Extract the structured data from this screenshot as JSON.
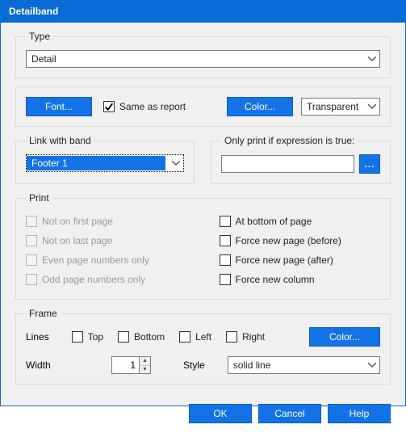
{
  "window": {
    "title": "Detailband"
  },
  "type_group": {
    "legend": "Type",
    "value": "Detail"
  },
  "font_row": {
    "font_btn": "Font...",
    "same_as_report": "Same as report",
    "color_btn": "Color...",
    "color_value": "Transparent"
  },
  "link_group": {
    "legend": "Link with band",
    "value": "Footer 1"
  },
  "expr_group": {
    "legend": "Only print if expression is true:",
    "value": "",
    "browse": "..."
  },
  "print_group": {
    "legend": "Print",
    "left": [
      "Not on first page",
      "Not on last page",
      "Even page numbers only",
      "Odd page numbers only"
    ],
    "right": [
      "At bottom of page",
      "Force new page (before)",
      "Force new page (after)",
      "Force new column"
    ]
  },
  "frame_group": {
    "legend": "Frame",
    "lines_label": "Lines",
    "top": "Top",
    "bottom": "Bottom",
    "left": "Left",
    "right": "Right",
    "color_btn": "Color...",
    "width_label": "Width",
    "width_value": "1",
    "style_label": "Style",
    "style_value": "solid line"
  },
  "buttons": {
    "ok": "OK",
    "cancel": "Cancel",
    "help": "Help"
  }
}
